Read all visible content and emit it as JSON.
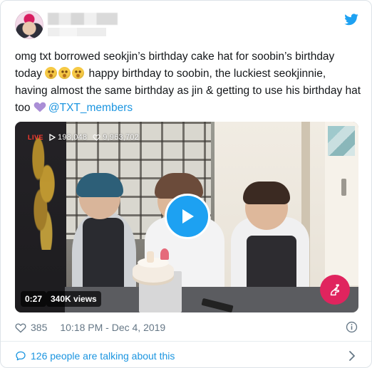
{
  "tweet": {
    "text_part1": "omg txt borrowed seokjin’s birthday cake hat for soobin’s birthday today",
    "text_part2": "happy birthday to soobin, the luckiest seokjinnie, having almost the same birthday as jin & getting to use his birthday hat too",
    "mention": "@TXT_members"
  },
  "video": {
    "live_label": "LIVE",
    "views_stat": "198,048",
    "hearts_stat": "9,963,702",
    "duration": "0:27",
    "views": "340K views"
  },
  "meta": {
    "likes": "385",
    "timestamp": "10:18 PM - Dec 4, 2019"
  },
  "footer": {
    "talking": "126 people are talking about this"
  },
  "colors": {
    "twitter_blue": "#1DA1F2",
    "link_blue": "#1B95E0",
    "secondary_text": "#657786",
    "heart_pink": "#E0245E"
  },
  "icons": [
    "twitter-bird-icon",
    "smiling-face-icon",
    "purple-heart-icon",
    "play-icon",
    "eye-icon",
    "heart-icon",
    "heart-hand-icon",
    "info-icon",
    "speech-bubble-icon",
    "chevron-right-icon"
  ]
}
